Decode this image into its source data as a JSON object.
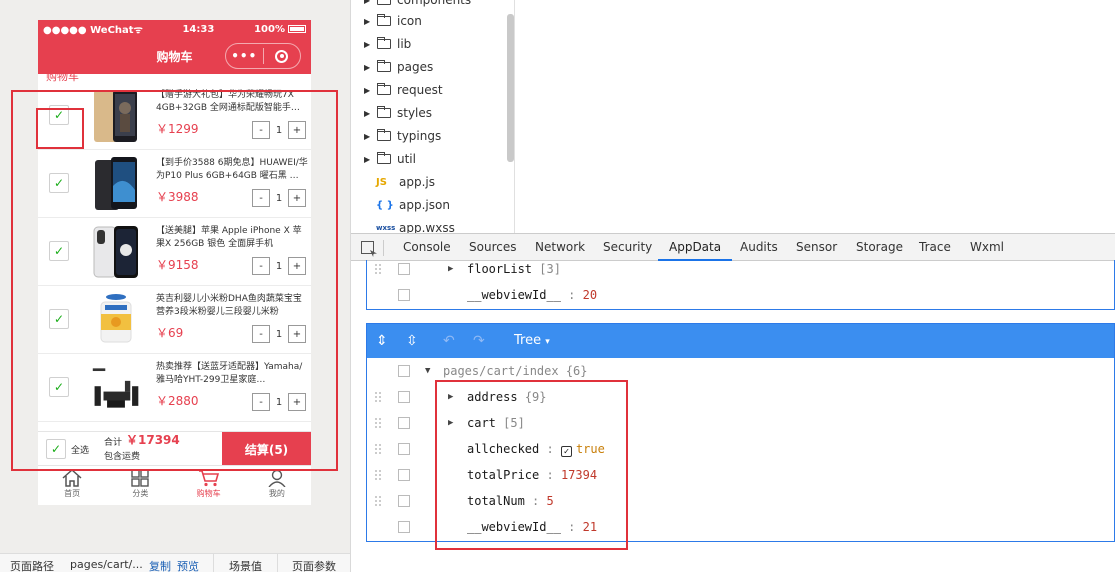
{
  "status_bar": {
    "carrier": "●●●●● WeChat",
    "wifi": "ᯤ",
    "time": "14:33",
    "battery": "100%"
  },
  "nav": {
    "title": "购物车",
    "menu_dots": "•••"
  },
  "partial_text": "购物车",
  "cart_items": [
    {
      "name": "【赠手游大礼包】华为荣耀畅玩7X 4GB+32GB 全网通标配版智能手…",
      "price": "￥1299",
      "qty": "1",
      "minus": "-",
      "plus": "+",
      "checked": "✓"
    },
    {
      "name": "【到手价3588 6期免息】HUAWEI/华为P10 Plus 6GB+64GB 曜石黑 …",
      "price": "￥3988",
      "qty": "1",
      "minus": "-",
      "plus": "+",
      "checked": "✓"
    },
    {
      "name": "【送美腿】苹果 Apple iPhone X 苹果X 256GB 银色 全面屏手机",
      "price": "￥9158",
      "qty": "1",
      "minus": "-",
      "plus": "+",
      "checked": "✓"
    },
    {
      "name": "英吉利婴儿小米粉DHA鱼肉蔬菜宝宝营养3段米粉婴儿三段婴儿米粉",
      "price": "￥69",
      "qty": "1",
      "minus": "-",
      "plus": "+",
      "checked": "✓"
    },
    {
      "name": "热卖推荐【送蓝牙适配器】Yamaha/雅马哈YHT-299卫星家庭…",
      "price": "￥2880",
      "qty": "1",
      "minus": "-",
      "plus": "+",
      "checked": "✓"
    }
  ],
  "footer": {
    "checked": "✓",
    "select_all": "全选",
    "total_label": "合计",
    "total_value": "￥17394",
    "shipping": "包含运费",
    "checkout": "结算(5)"
  },
  "tabs": [
    {
      "label": "首页",
      "icon": "home-icon"
    },
    {
      "label": "分类",
      "icon": "category-icon"
    },
    {
      "label": "购物车",
      "icon": "cart-icon"
    },
    {
      "label": "我的",
      "icon": "user-icon"
    }
  ],
  "path_bar": {
    "label": "页面路径",
    "path": "pages/cart/...",
    "copy": "复制",
    "preview": "预览",
    "scene": "场景值",
    "params": "页面参数"
  },
  "file_tree": [
    {
      "name": "components",
      "type": "folder"
    },
    {
      "name": "icon",
      "type": "folder"
    },
    {
      "name": "lib",
      "type": "folder"
    },
    {
      "name": "pages",
      "type": "folder"
    },
    {
      "name": "request",
      "type": "folder"
    },
    {
      "name": "styles",
      "type": "folder"
    },
    {
      "name": "typings",
      "type": "folder"
    },
    {
      "name": "util",
      "type": "folder"
    },
    {
      "name": "app.js",
      "type": "js",
      "icon": "JS"
    },
    {
      "name": "app.json",
      "type": "json",
      "icon": "{ }"
    },
    {
      "name": "app.wxss",
      "type": "wxss",
      "icon": "wxss"
    }
  ],
  "devtools_tabs": [
    "Console",
    "Sources",
    "Network",
    "Security",
    "AppData",
    "Audits",
    "Sensor",
    "Storage",
    "Trace",
    "Wxml"
  ],
  "appdata": {
    "panel1": [
      {
        "key": "floorList",
        "value": "[3]",
        "expandable": true
      },
      {
        "key": "__webviewId__",
        "value": "20",
        "expandable": false
      }
    ],
    "toolbar": {
      "view_mode": "Tree"
    },
    "panel2_root": {
      "key": "pages/cart/index",
      "value": "{6}"
    },
    "panel2": [
      {
        "key": "address",
        "value": "{9}",
        "expandable": true
      },
      {
        "key": "cart",
        "value": "[5]",
        "expandable": true
      },
      {
        "key": "allchecked",
        "value": "true",
        "bool": true
      },
      {
        "key": "totalPrice",
        "value": "17394"
      },
      {
        "key": "totalNum",
        "value": "5"
      },
      {
        "key": "__webviewId__",
        "value": "21"
      }
    ]
  },
  "colors": {
    "brand_red": "#e6404f",
    "devtools_blue": "#3b8ef0",
    "annotation_red": "#e0313b"
  }
}
